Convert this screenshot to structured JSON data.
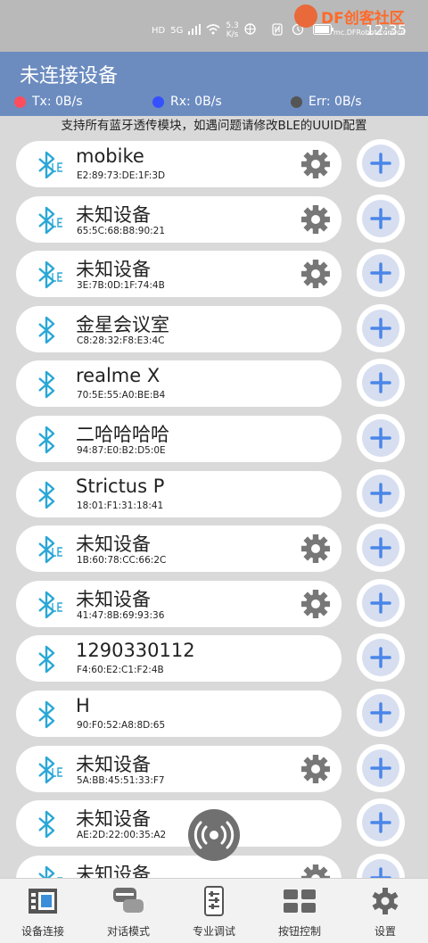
{
  "status_bar": {
    "left_badges": "HD",
    "net": "5G",
    "speed_top": "5.3",
    "speed_bottom": "K/s",
    "time": "12:35",
    "brand_logo": "DF创客社区",
    "brand_sub": "mc.DFRobot.com.cn"
  },
  "header": {
    "title": "未连接设备",
    "tx": "Tx: 0B/s",
    "rx": "Rx: 0B/s",
    "err": "Err: 0B/s",
    "tx_color": "#ff4d5e",
    "rx_color": "#3550ff",
    "err_color": "#555555"
  },
  "notice": "支持所有蓝牙透传模块，如遇问题请修改BLE的UUID配置",
  "devices": [
    {
      "name": "mobike",
      "mac": "E2:89:73:DE:1F:3D",
      "icon": "bluetooth-le-icon",
      "has_settings": true
    },
    {
      "name": "未知设备",
      "mac": "65:5C:68:B8:90:21",
      "icon": "bluetooth-le-icon",
      "has_settings": true
    },
    {
      "name": "未知设备",
      "mac": "3E:7B:0D:1F:74:4B",
      "icon": "bluetooth-le-icon",
      "has_settings": true
    },
    {
      "name": "金星会议室",
      "mac": "C8:28:32:F8:E3:4C",
      "icon": "bluetooth-icon",
      "has_settings": false
    },
    {
      "name": "realme X",
      "mac": "70:5E:55:A0:BE:B4",
      "icon": "bluetooth-icon",
      "has_settings": false
    },
    {
      "name": "二哈哈哈哈",
      "mac": "94:87:E0:B2:D5:0E",
      "icon": "bluetooth-icon",
      "has_settings": false
    },
    {
      "name": "Strictus P",
      "mac": "18:01:F1:31:18:41",
      "icon": "bluetooth-icon",
      "has_settings": false
    },
    {
      "name": "未知设备",
      "mac": "1B:60:78:CC:66:2C",
      "icon": "bluetooth-le-icon",
      "has_settings": true
    },
    {
      "name": "未知设备",
      "mac": "41:47:8B:69:93:36",
      "icon": "bluetooth-le-icon",
      "has_settings": true
    },
    {
      "name": "1290330112",
      "mac": "F4:60:E2:C1:F2:4B",
      "icon": "bluetooth-icon",
      "has_settings": false
    },
    {
      "name": "H",
      "mac": "90:F0:52:A8:8D:65",
      "icon": "bluetooth-icon",
      "has_settings": false
    },
    {
      "name": "未知设备",
      "mac": "5A:BB:45:51:33:F7",
      "icon": "bluetooth-le-icon",
      "has_settings": true
    },
    {
      "name": "未知设备",
      "mac": "AE:2D:22:00:35:A2",
      "icon": "bluetooth-icon",
      "has_settings": false
    },
    {
      "name": "未知设备",
      "mac": "",
      "icon": "bluetooth-le-icon",
      "has_settings": true
    }
  ],
  "nav": [
    {
      "label": "设备连接",
      "icon": "device-connect-icon"
    },
    {
      "label": "对话模式",
      "icon": "chat-icon"
    },
    {
      "label": "专业调试",
      "icon": "debug-icon"
    },
    {
      "label": "按钮控制",
      "icon": "button-grid-icon"
    },
    {
      "label": "设置",
      "icon": "gear-icon"
    }
  ],
  "colors": {
    "accent": "#6c8cc0",
    "bt_blue": "#29a7d6",
    "plus_blue": "#4a86e8",
    "gear_gray": "#777777"
  }
}
